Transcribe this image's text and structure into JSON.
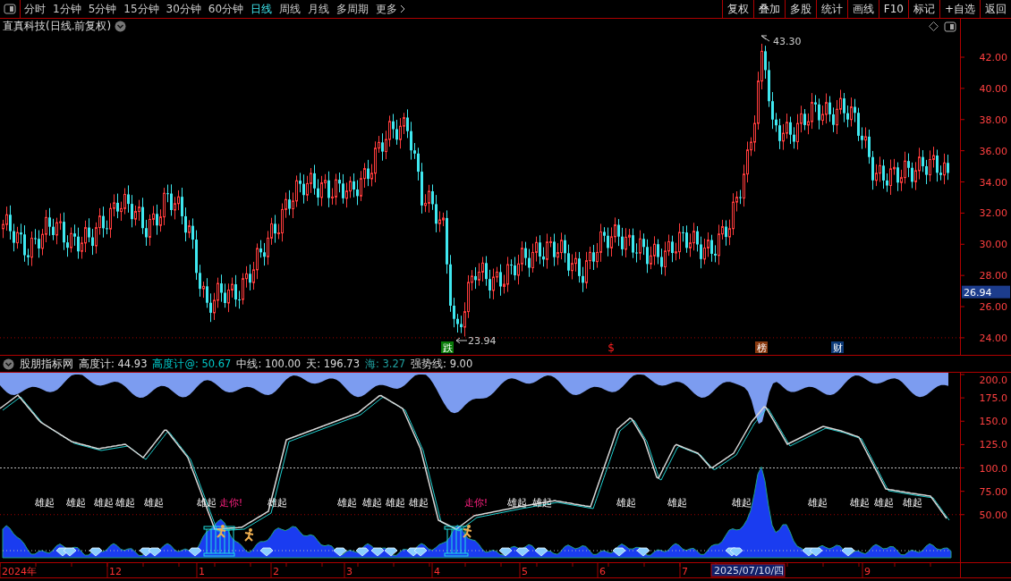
{
  "toolbar": {
    "periods": [
      {
        "label": "分时",
        "selected": false
      },
      {
        "label": "1分钟",
        "selected": false
      },
      {
        "label": "5分钟",
        "selected": false
      },
      {
        "label": "15分钟",
        "selected": false
      },
      {
        "label": "30分钟",
        "selected": false
      },
      {
        "label": "60分钟",
        "selected": false
      },
      {
        "label": "日线",
        "selected": true
      },
      {
        "label": "周线",
        "selected": false
      },
      {
        "label": "月线",
        "selected": false
      },
      {
        "label": "多周期",
        "selected": false
      }
    ],
    "more": "更多",
    "actions": [
      "复权",
      "叠加",
      "多股",
      "统计",
      "画线",
      "F10",
      "标记",
      "+自选",
      "返回"
    ]
  },
  "chart": {
    "title": "直真科技(日线.前复权)",
    "price_ticks": [
      "42.00",
      "40.00",
      "38.00",
      "36.00",
      "34.00",
      "32.00",
      "30.00",
      "28.00",
      "26.00",
      "24.00"
    ],
    "current_price": "26.94",
    "high_label": "43.30",
    "low_label": "23.94",
    "event_marks": [
      {
        "text": "跌",
        "kind": "badge",
        "color": "#087a08"
      },
      {
        "text": "$",
        "kind": "plain",
        "color": "#ff2020"
      },
      {
        "text": "榜",
        "kind": "badge",
        "color": "#8a3a10"
      },
      {
        "text": "财",
        "kind": "badge",
        "color": "#0c3a78"
      }
    ]
  },
  "indicator": {
    "name": "股朋指标网",
    "values": [
      {
        "text": "高度计: 44.93",
        "kind": "main"
      },
      {
        "text": "高度计@: 50.67",
        "kind": "average"
      },
      {
        "text": "中线: 100.00",
        "kind": "main"
      },
      {
        "text": "天: 196.73",
        "kind": "main"
      },
      {
        "text": "海: 3.27",
        "kind": "sea"
      },
      {
        "text": "强势线: 9.00",
        "kind": "main"
      }
    ],
    "ticks": [
      "200.0",
      "175.0",
      "150.0",
      "125.0",
      "100.0",
      "75.00",
      "50.00"
    ],
    "signals": [
      {
        "text": "雄起",
        "kind": "rise"
      },
      {
        "text": "雄起",
        "kind": "rise"
      },
      {
        "text": "雄起",
        "kind": "rise"
      },
      {
        "text": "雄起",
        "kind": "rise"
      },
      {
        "text": "雄起",
        "kind": "rise"
      },
      {
        "text": "雄起",
        "kind": "rise"
      },
      {
        "text": "走你!",
        "kind": "go"
      },
      {
        "text": "雄起",
        "kind": "rise"
      },
      {
        "text": "雄起",
        "kind": "rise"
      },
      {
        "text": "雄起",
        "kind": "rise"
      },
      {
        "text": "雄起",
        "kind": "rise"
      },
      {
        "text": "雄起",
        "kind": "rise"
      },
      {
        "text": "走你!",
        "kind": "go"
      },
      {
        "text": "雄起",
        "kind": "rise"
      },
      {
        "text": "雄起",
        "kind": "rise"
      },
      {
        "text": "雄起",
        "kind": "rise"
      },
      {
        "text": "雄起",
        "kind": "rise"
      },
      {
        "text": "雄起",
        "kind": "rise"
      },
      {
        "text": "雄起",
        "kind": "rise"
      },
      {
        "text": "雄起",
        "kind": "rise"
      },
      {
        "text": "雄起",
        "kind": "rise"
      },
      {
        "text": "雄起",
        "kind": "rise"
      }
    ]
  },
  "date_axis": {
    "labels": [
      "2024年",
      "12",
      "1",
      "2",
      "3",
      "4",
      "5",
      "6",
      "7",
      "9"
    ],
    "cursor_date": "2025/07/10/四"
  }
}
